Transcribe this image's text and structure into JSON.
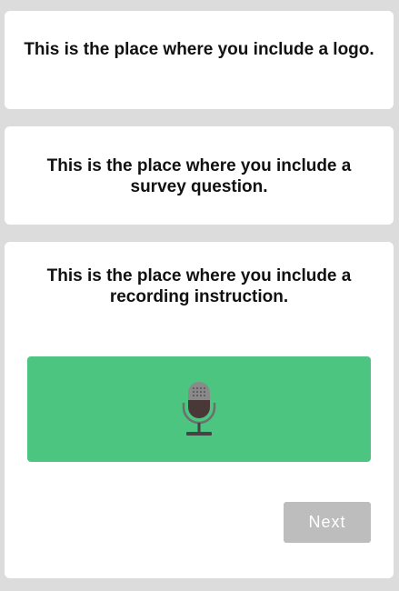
{
  "logo_card": {
    "text": "This is the place where you include a logo."
  },
  "question_card": {
    "text": "This is the place where you include a survey question."
  },
  "recording_card": {
    "instruction": "This is the place where you include a recording instruction.",
    "record_button": {
      "icon": "microphone-icon",
      "color": "#4bc57f"
    },
    "next_label": "Next"
  },
  "colors": {
    "background": "#dcdcdc",
    "card": "#ffffff",
    "accent": "#4bc57f",
    "disabled_button": "#bdbdbd"
  }
}
